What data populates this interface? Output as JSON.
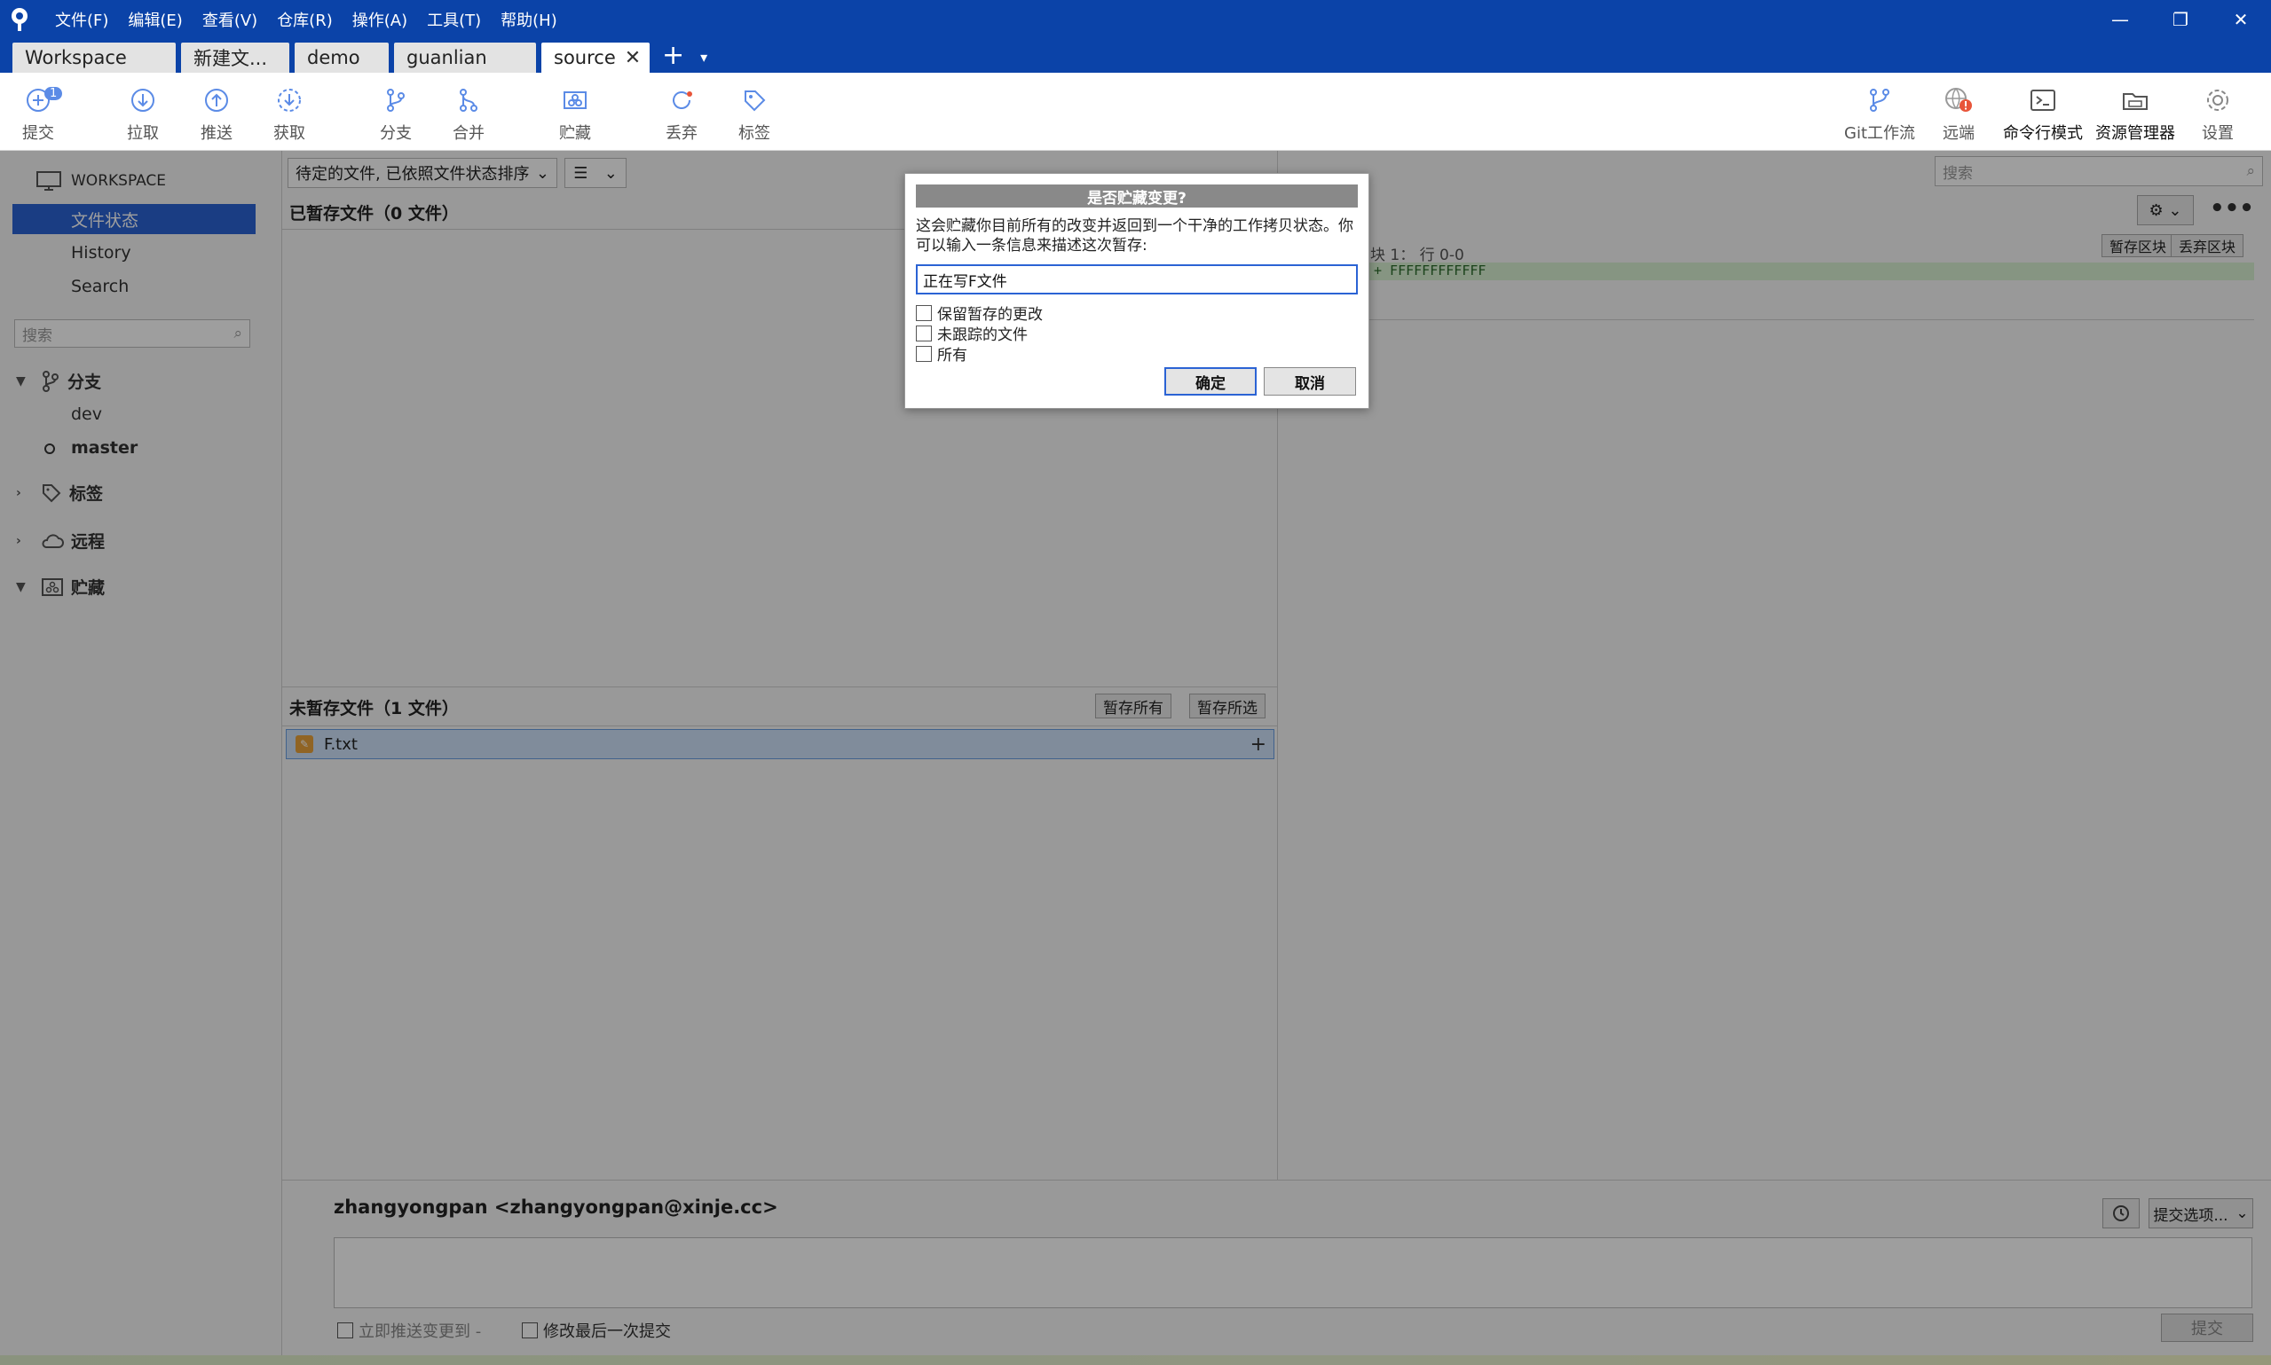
{
  "menu": [
    "文件(F)",
    "编辑(E)",
    "查看(V)",
    "仓库(R)",
    "操作(A)",
    "工具(T)",
    "帮助(H)"
  ],
  "window_controls": {
    "minimize": "—",
    "restore": "❐",
    "close": "✕"
  },
  "tabs": [
    {
      "label": "Workspace"
    },
    {
      "label": "新建文..."
    },
    {
      "label": "demo"
    },
    {
      "label": "guanlian"
    },
    {
      "label": "source",
      "active": true
    }
  ],
  "tab_add": "+",
  "tab_more": "▾",
  "toolbar": {
    "commit": {
      "label": "提交",
      "badge": "1"
    },
    "pull": "拉取",
    "push": "推送",
    "fetch": "获取",
    "branch": "分支",
    "merge": "合并",
    "stash": "贮藏",
    "discard": "丢弃",
    "tag": "标签",
    "git_flow": "Git工作流",
    "remote": "远端",
    "terminal": "命令行模式",
    "explorer": "资源管理器",
    "settings": "设置"
  },
  "sidebar": {
    "workspace": "WORKSPACE",
    "items": [
      {
        "label": "文件状态",
        "active": true
      },
      {
        "label": "History"
      },
      {
        "label": "Search"
      }
    ],
    "search_placeholder": "搜索",
    "groups": {
      "branches": "分支",
      "tags": "标签",
      "remotes": "远程",
      "stashes": "贮藏"
    },
    "branches": [
      {
        "name": "dev"
      },
      {
        "name": "master",
        "current": true
      }
    ]
  },
  "main": {
    "sort_select": "待定的文件, 已依照文件状态排序",
    "view_select": "☰",
    "staged_header": "已暂存文件（0 文件）",
    "unstaged_header": "未暂存文件（1 文件）",
    "stage_all": "暂存所有",
    "stage_selected": "暂存所选",
    "files": [
      {
        "name": "F.txt"
      }
    ],
    "right_search_placeholder": "搜索",
    "hunk_label": "块 1： 行 0-0",
    "stage_hunk": "暂存区块",
    "discard_hunk": "丢弃区块",
    "diff_line": "+ FFFFFFFFFFFF"
  },
  "commit": {
    "author": "zhangyongpan <zhangyongpan@xinje.cc>",
    "push_now": "立即推送变更到 -",
    "amend_last": "修改最后一次提交",
    "submit": "提交",
    "options": "提交选项..."
  },
  "dialog": {
    "title": "是否贮藏变更?",
    "message": "这会贮藏你目前所有的改变并返回到一个干净的工作拷贝状态。你可以输入一条信息来描述这次暂存:",
    "input_value": "正在写F文件",
    "options": [
      "保留暂存的更改",
      "未跟踪的文件",
      "所有"
    ],
    "ok": "确定",
    "cancel": "取消"
  }
}
